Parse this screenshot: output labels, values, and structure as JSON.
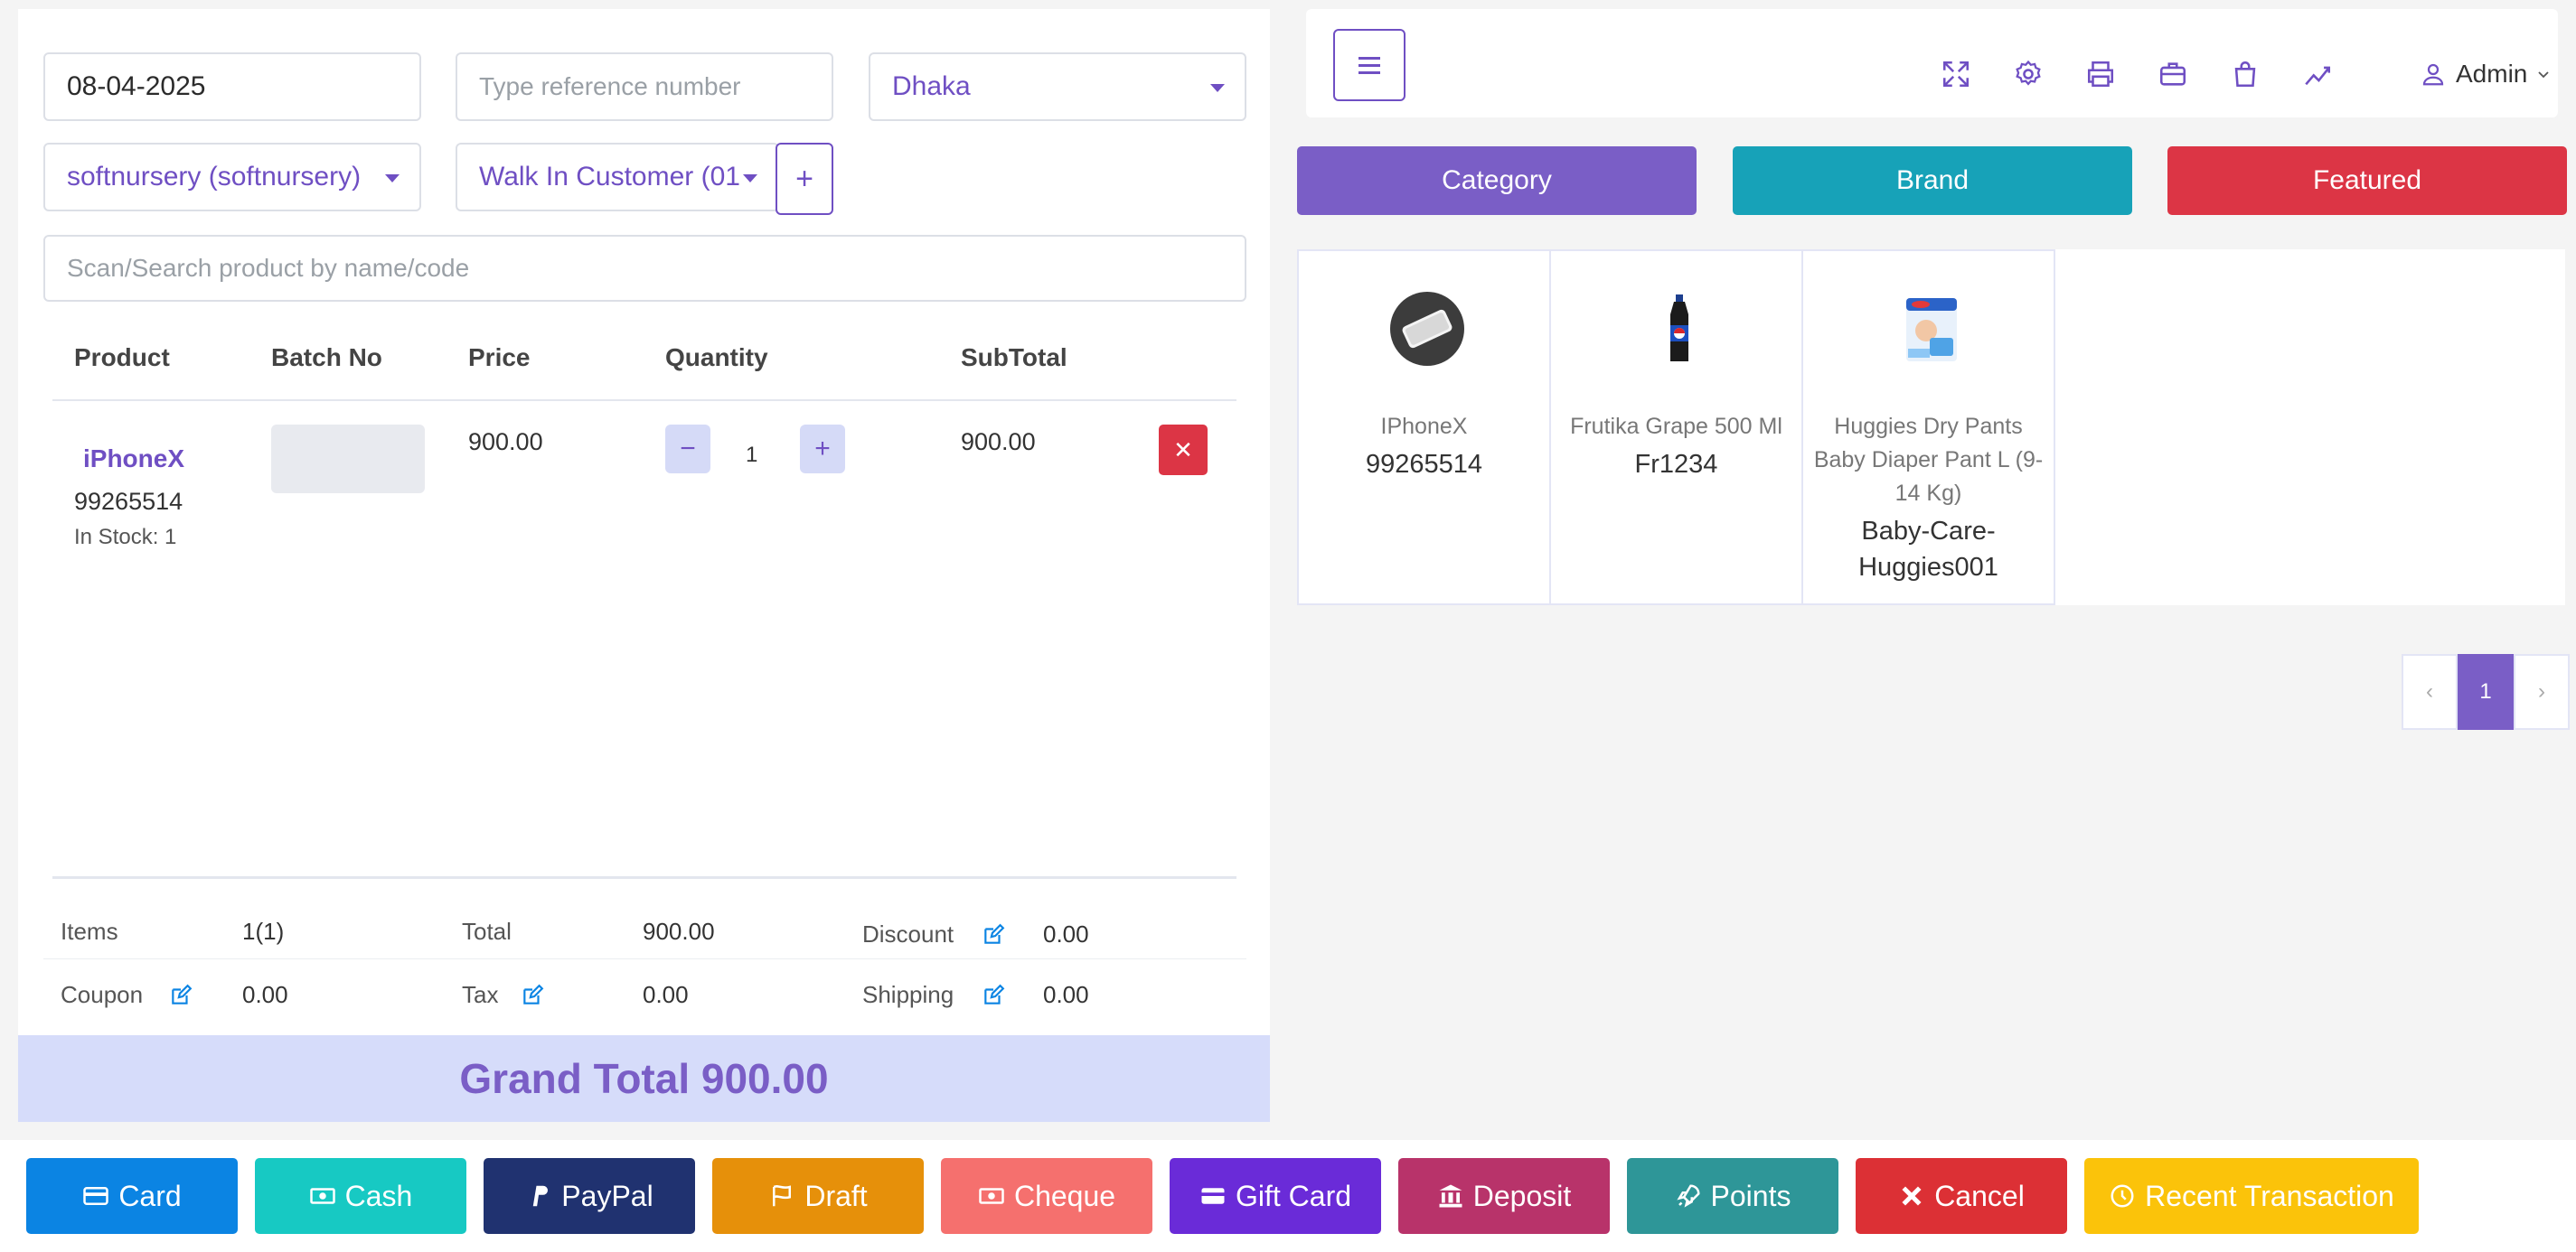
{
  "form": {
    "date": "08-04-2025",
    "reference_placeholder": "Type reference number",
    "warehouse": "Dhaka",
    "biller": "softnursery (softnursery)",
    "customer": "Walk In Customer (01",
    "add_customer": "+",
    "search_placeholder": "Scan/Search product by name/code"
  },
  "table": {
    "headers": [
      "Product",
      "Batch No",
      "Price",
      "Quantity",
      "SubTotal"
    ],
    "rows": [
      {
        "name": "iPhoneX",
        "code": "99265514",
        "stock": "In Stock: 1",
        "price": "900.00",
        "qty": "1",
        "subtotal": "900.00",
        "minus": "−",
        "plus": "+",
        "delete": "✕"
      }
    ]
  },
  "summary": {
    "items_label": "Items",
    "items_value": "1(1)",
    "total_label": "Total",
    "total_value": "900.00",
    "discount_label": "Discount",
    "discount_value": "0.00",
    "coupon_label": "Coupon",
    "coupon_value": "0.00",
    "tax_label": "Tax",
    "tax_value": "0.00",
    "shipping_label": "Shipping",
    "shipping_value": "0.00",
    "grand_total": "Grand Total 900.00"
  },
  "topbar": {
    "icons": [
      "fullscreen-icon",
      "settings-icon",
      "print-icon",
      "briefcase-icon",
      "shopping-bag-icon",
      "chart-line-icon"
    ],
    "user": "Admin"
  },
  "tabs": [
    {
      "label": "Category",
      "color": "#7a5ec6"
    },
    {
      "label": "Brand",
      "color": "#17a2b8"
    },
    {
      "label": "Featured",
      "color": "#dc3545"
    }
  ],
  "products": [
    {
      "name": "IPhoneX",
      "code": "99265514"
    },
    {
      "name": "Frutika Grape 500 Ml",
      "code": "Fr1234"
    },
    {
      "name": "Huggies Dry Pants Baby Diaper Pant L (9-14 Kg)",
      "code": "Baby-Care-Huggies001"
    }
  ],
  "pagination": {
    "prev": "‹",
    "current": "1",
    "next": "›"
  },
  "payments": [
    {
      "label": "Card",
      "icon": "credit-card-icon",
      "color": "#0b84e3"
    },
    {
      "label": "Cash",
      "icon": "money-icon",
      "color": "#17c9c3"
    },
    {
      "label": "PayPal",
      "icon": "paypal-icon",
      "color": "#203270"
    },
    {
      "label": "Draft",
      "icon": "flag-icon",
      "color": "#e6900a"
    },
    {
      "label": "Cheque",
      "icon": "money-icon",
      "color": "#f5706e"
    },
    {
      "label": "Gift Card",
      "icon": "credit-card-icon",
      "color": "#6a2bd8"
    },
    {
      "label": "Deposit",
      "icon": "bank-icon",
      "color": "#b8336a"
    },
    {
      "label": "Points",
      "icon": "rocket-icon",
      "color": "#2e9698"
    },
    {
      "label": "Cancel",
      "icon": "close-icon",
      "color": "#dc3035"
    },
    {
      "label": "Recent Transaction",
      "icon": "clock-icon",
      "color": "#fbc30a"
    }
  ]
}
